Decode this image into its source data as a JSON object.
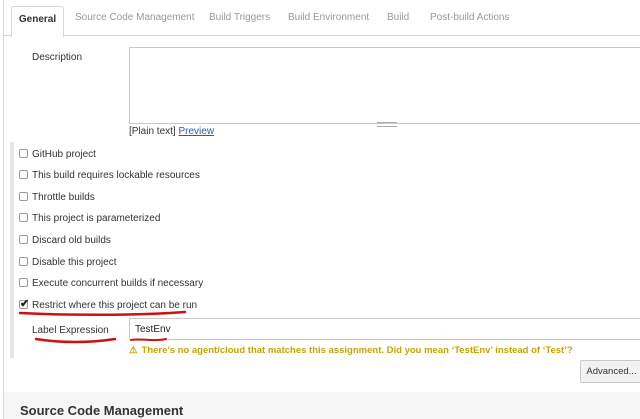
{
  "tabs": [
    {
      "label": "General",
      "active": true
    },
    {
      "label": "Source Code Management",
      "active": false
    },
    {
      "label": "Build Triggers",
      "active": false
    },
    {
      "label": "Build Environment",
      "active": false
    },
    {
      "label": "Build",
      "active": false
    },
    {
      "label": "Post-build Actions",
      "active": false
    }
  ],
  "description": {
    "label": "Description",
    "value": "",
    "plain_text": "[Plain text]",
    "preview_link": "Preview"
  },
  "options": [
    {
      "label": "GitHub project",
      "checked": false
    },
    {
      "label": "This build requires lockable resources",
      "checked": false
    },
    {
      "label": "Throttle builds",
      "checked": false
    },
    {
      "label": "This project is parameterized",
      "checked": false
    },
    {
      "label": "Discard old builds",
      "checked": false
    },
    {
      "label": "Disable this project",
      "checked": false
    },
    {
      "label": "Execute concurrent builds if necessary",
      "checked": false
    },
    {
      "label": "Restrict where this project can be run",
      "checked": true
    }
  ],
  "label_expression": {
    "label": "Label Expression",
    "value": "TestEnv"
  },
  "warning": {
    "icon": "warning-icon",
    "text": "There’s no agent/cloud that matches this assignment. Did you mean ‘TestEnv’ instead of ‘Test’?"
  },
  "advanced_button": "Advanced...",
  "next_section_title": "Source Code Management",
  "colors": {
    "warning": "#c8a400",
    "link": "#2a5ea8",
    "annotation": "#cc1111"
  }
}
